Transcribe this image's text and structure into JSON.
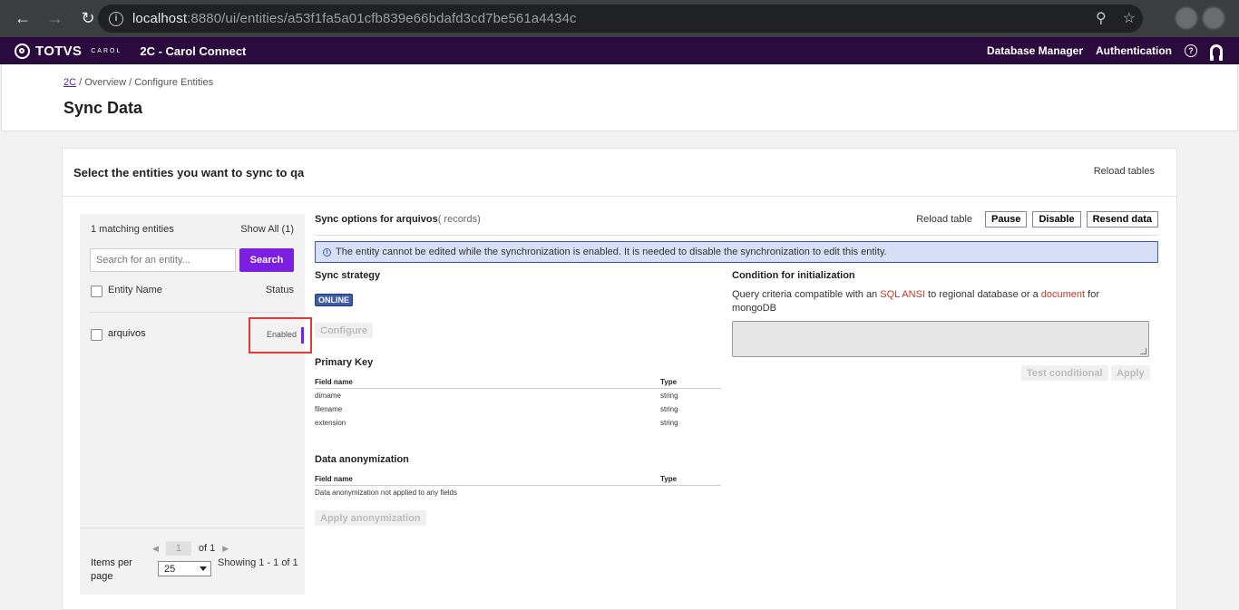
{
  "browser": {
    "url_host": "localhost",
    "url_rest": ":8880/ui/entities/a53f1fa5a01cfb839e66bdafd3cd7be561a4434c"
  },
  "app": {
    "brand": "TOTVS",
    "brand_sub": "CAROL",
    "title": "2C - Carol Connect",
    "nav": [
      "Database Manager",
      "Authentication"
    ],
    "help_glyph": "?"
  },
  "page": {
    "breadcrumb_link": "2C",
    "breadcrumb_rest": " / Overview / Configure Entities",
    "title": "Sync Data"
  },
  "card": {
    "title": "Select the entities you want to sync to qa",
    "reload_tables": "Reload tables"
  },
  "entities": {
    "count_label": "1 matching entities",
    "show_all": "Show All (1)",
    "search_placeholder": "Search for an entity...",
    "search_button": "Search",
    "col_name": "Entity Name",
    "col_status": "Status",
    "rows": [
      {
        "name": "arquivos",
        "status": "Enabled"
      }
    ],
    "pager": {
      "page": "1",
      "of": "of 1",
      "items_per_page_label": "Items per page",
      "items_per_page_value": "25",
      "showing": "Showing 1 - 1 of 1"
    }
  },
  "sync": {
    "title_bold": "Sync options for arquivos",
    "title_records": "( records)",
    "reload_table": "Reload table",
    "pause": "Pause",
    "disable": "Disable",
    "resend": "Resend data",
    "alert": "The entity cannot be edited while the synchronization is enabled. It is needed to disable the synchronization to edit this entity.",
    "strategy_title": "Sync strategy",
    "strategy_badge": "ONLINE",
    "configure": "Configure",
    "pk_title": "Primary Key",
    "field_name_col": "Field name",
    "type_col": "Type",
    "pk_rows": [
      {
        "field": "dirname",
        "type": "string"
      },
      {
        "field": "filename",
        "type": "string"
      },
      {
        "field": "extension",
        "type": "string"
      }
    ],
    "anon_title": "Data anonymization",
    "anon_empty": "Data anonymization not applied to any fields",
    "apply_anon": "Apply anonymization",
    "cond_title": "Condition for initialization",
    "cond_desc_1": "Query criteria compatible with an ",
    "cond_link_1": "SQL ANSI",
    "cond_desc_2": " to regional database or a ",
    "cond_link_2": "document",
    "cond_desc_3": " for mongoDB",
    "test_conditional": "Test conditional",
    "apply": "Apply"
  }
}
